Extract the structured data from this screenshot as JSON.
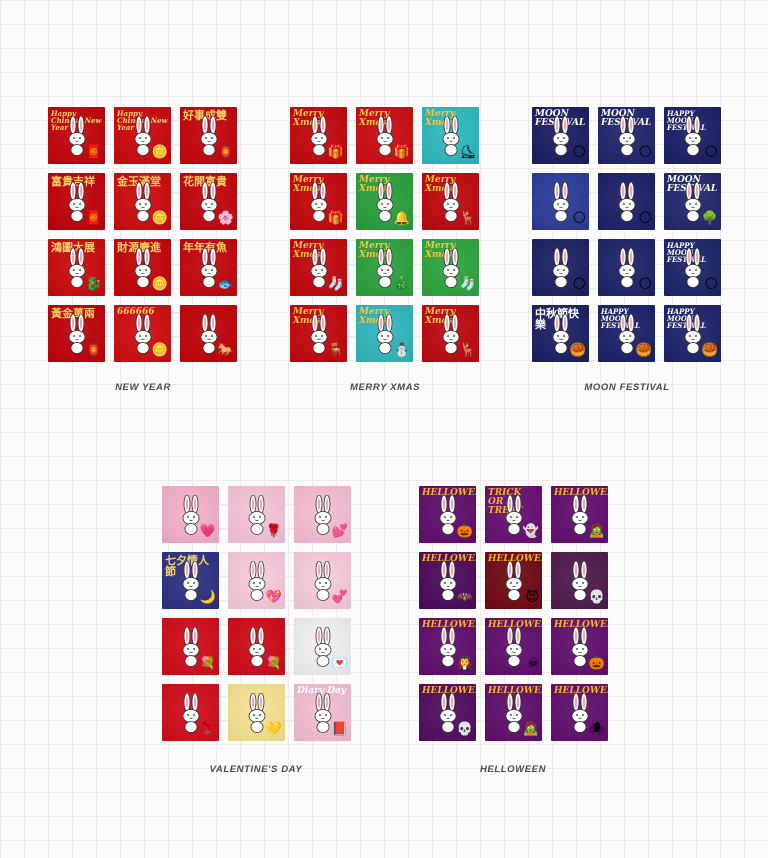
{
  "groups": [
    {
      "key": "newyear",
      "caption": "NEW YEAR",
      "tiles": [
        {
          "bg": "#c8141b",
          "text": "Happy Chinese New Year",
          "tc": "#f5d36a",
          "deco": "🧧"
        },
        {
          "bg": "#d0181e",
          "text": "Happy Chinese New Year",
          "tc": "#f5d36a",
          "deco": "🪙"
        },
        {
          "bg": "#c9151c",
          "text": "好事成雙",
          "tc": "#f3cf62",
          "deco": "🏮"
        },
        {
          "bg": "#c5131a",
          "text": "富貴吉祥",
          "tc": "#f3cf62",
          "deco": "🧧"
        },
        {
          "bg": "#d11c1f",
          "text": "金玉滿堂",
          "tc": "#f3cf62",
          "deco": "🪙"
        },
        {
          "bg": "#c7161c",
          "text": "花開富貴",
          "tc": "#f3cf62",
          "deco": "🌸"
        },
        {
          "bg": "#cf1a1e",
          "text": "鴻圖大展",
          "tc": "#f3cf62",
          "deco": "🐉"
        },
        {
          "bg": "#c8151c",
          "text": "財源廣進",
          "tc": "#f3cf62",
          "deco": "🪙"
        },
        {
          "bg": "#c9171d",
          "text": "年年有魚",
          "tc": "#f3cf62",
          "deco": "🐟"
        },
        {
          "bg": "#c4131a",
          "text": "黃金萬兩",
          "tc": "#f3cf62",
          "deco": "🏮"
        },
        {
          "bg": "#d31d21",
          "text": "666666",
          "tc": "#f3cf62",
          "deco": "🪙"
        },
        {
          "bg": "#c6141b",
          "text": "",
          "tc": "#f3cf62",
          "deco": "🐎"
        }
      ]
    },
    {
      "key": "xmas",
      "caption": "MERRY XMAS",
      "tiles": [
        {
          "bg": "#c8181e",
          "text": "Merry Xmas",
          "tc": "#f4c542",
          "deco": "🎁"
        },
        {
          "bg": "#cf1d22",
          "text": "Merry Xmas",
          "tc": "#f4c542",
          "deco": "🎁"
        },
        {
          "bg": "#3bbfc4",
          "text": "Merry Xmas",
          "tc": "#f4c542",
          "deco": "⛸"
        },
        {
          "bg": "#c8181e",
          "text": "Merry Xmas",
          "tc": "#f4c542",
          "deco": "🎁"
        },
        {
          "bg": "#3aa64a",
          "text": "Merry Xmas",
          "tc": "#f4c542",
          "deco": "🔔"
        },
        {
          "bg": "#c41a1f",
          "text": "Merry Xmas",
          "tc": "#f4c542",
          "deco": "🦌"
        },
        {
          "bg": "#c8181e",
          "text": "Merry Xmas",
          "tc": "#f4c542",
          "deco": "🧦"
        },
        {
          "bg": "#3aa84b",
          "text": "Merry Xmas",
          "tc": "#f4c542",
          "deco": "🎄"
        },
        {
          "bg": "#3bab4c",
          "text": "Merry Xmas",
          "tc": "#f4c542",
          "deco": "🧦"
        },
        {
          "bg": "#c8181e",
          "text": "Merry Xmas",
          "tc": "#f4c542",
          "deco": "🪑"
        },
        {
          "bg": "#3fbcc2",
          "text": "Merry Xmas",
          "tc": "#f4c542",
          "deco": "⛄"
        },
        {
          "bg": "#c31a1f",
          "text": "Merry Xmas",
          "tc": "#f4c542",
          "deco": "🦌"
        }
      ]
    },
    {
      "key": "moon",
      "caption": "MOON FESTIVAL",
      "tiles": [
        {
          "bg": "#2a2d6e",
          "text": "MOON FESTIVAL",
          "tc": "#ffffff",
          "deco": "🌕"
        },
        {
          "bg": "#2f3378",
          "text": "MOON FESTIVAL",
          "tc": "#ffffff",
          "deco": "🌕"
        },
        {
          "bg": "#2a2e72",
          "text": "HAPPY MOON FESTIVAL",
          "tc": "#ffffff",
          "deco": "🌕"
        },
        {
          "bg": "#3a4aa0",
          "text": "",
          "tc": "#ffffff",
          "deco": "🌕"
        },
        {
          "bg": "#2b2f74",
          "text": "",
          "tc": "#ffffff",
          "deco": "🌕"
        },
        {
          "bg": "#303678",
          "text": "MOON FESTIVAL",
          "tc": "#ffffff",
          "deco": "🌳"
        },
        {
          "bg": "#2c306f",
          "text": "",
          "tc": "#ffffff",
          "deco": "🌕"
        },
        {
          "bg": "#2d3274",
          "text": "",
          "tc": "#ffffff",
          "deco": "🌕"
        },
        {
          "bg": "#2c3373",
          "text": "HAPPY MOON FESTIVAL",
          "tc": "#ffffff",
          "deco": "🌕"
        },
        {
          "bg": "#2a2f6f",
          "text": "中秋節快樂",
          "tc": "#ffffff",
          "deco": "🥮"
        },
        {
          "bg": "#2b3074",
          "text": "HAPPY MOON FESTIVAL",
          "tc": "#ffffff",
          "deco": "🥮"
        },
        {
          "bg": "#2d3175",
          "text": "HAPPY MOON FESTIVAL",
          "tc": "#ffffff",
          "deco": "🥮"
        }
      ]
    },
    {
      "key": "valentine",
      "caption": "VALENTINE'S DAY",
      "tiles": [
        {
          "bg": "#f7b6d0",
          "text": "",
          "tc": "#c2185b",
          "deco": "💗"
        },
        {
          "bg": "#f7c9dc",
          "text": "",
          "tc": "#c2185b",
          "deco": "🌹"
        },
        {
          "bg": "#f8c3d7",
          "text": "",
          "tc": "#c2185b",
          "deco": "💕"
        },
        {
          "bg": "#3b3f8c",
          "text": "七夕情人節",
          "tc": "#f5d36a",
          "deco": "🌙"
        },
        {
          "bg": "#f9cfe0",
          "text": "",
          "tc": "#c2185b",
          "deco": "💖"
        },
        {
          "bg": "#f8d0e0",
          "text": "",
          "tc": "#c2185b",
          "deco": "💞"
        },
        {
          "bg": "#d51c2a",
          "text": "",
          "tc": "#ffffff",
          "deco": "💐"
        },
        {
          "bg": "#d41b28",
          "text": "",
          "tc": "#ffffff",
          "deco": "💐"
        },
        {
          "bg": "#f2f2f2",
          "text": "",
          "tc": "#999999",
          "deco": "💌"
        },
        {
          "bg": "#d51d2b",
          "text": "",
          "tc": "#ffffff",
          "deco": "🌹"
        },
        {
          "bg": "#f7e59a",
          "text": "",
          "tc": "#c2185b",
          "deco": "💛"
        },
        {
          "bg": "#f5c2d6",
          "text": "Diary Day",
          "tc": "#ffffff",
          "deco": "📕"
        }
      ]
    },
    {
      "key": "halloween",
      "caption": "HELLOWEEN",
      "tiles": [
        {
          "bg": "#6a1e78",
          "text": "HELLOWEEN",
          "tc": "#f5b324",
          "deco": "🎃"
        },
        {
          "bg": "#72207c",
          "text": "TRICK OR TREAT",
          "tc": "#f5b324",
          "deco": "👻"
        },
        {
          "bg": "#6b1f79",
          "text": "HELLOWEEN",
          "tc": "#f5b324",
          "deco": "🧟"
        },
        {
          "bg": "#5a1a6a",
          "text": "HELLOWEEN",
          "tc": "#f5b324",
          "deco": "🦇"
        },
        {
          "bg": "#7a1a22",
          "text": "HELLOWEEN",
          "tc": "#f5b324",
          "deco": "😈"
        },
        {
          "bg": "#5b2a58",
          "text": "",
          "tc": "#f5b324",
          "deco": "💀"
        },
        {
          "bg": "#6a1e78",
          "text": "HELLOWEEN",
          "tc": "#f5b324",
          "deco": "🧛"
        },
        {
          "bg": "#6b1f79",
          "text": "HELLOWEEN",
          "tc": "#f5b324",
          "deco": "☠"
        },
        {
          "bg": "#6c2079",
          "text": "HELLOWEEN",
          "tc": "#f5b324",
          "deco": "🎃"
        },
        {
          "bg": "#5e1c6c",
          "text": "HELLOWEEN",
          "tc": "#f5b324",
          "deco": "💀"
        },
        {
          "bg": "#6a1f77",
          "text": "HELLOWEEN",
          "tc": "#f5b324",
          "deco": "🧟"
        },
        {
          "bg": "#6b1f79",
          "text": "HELLOWEEN",
          "tc": "#f5b324",
          "deco": "🕷"
        }
      ]
    }
  ]
}
